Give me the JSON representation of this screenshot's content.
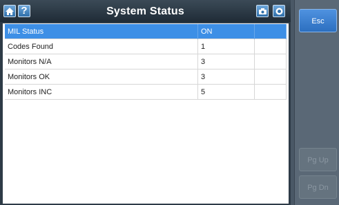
{
  "header": {
    "title": "System Status",
    "help_label": "?",
    "icons": [
      "home-icon",
      "help-icon",
      "camera-icon",
      "record-icon"
    ]
  },
  "table": {
    "rows": [
      {
        "name": "MIL Status",
        "value": "ON",
        "extra": "",
        "selected": true
      },
      {
        "name": "Codes Found",
        "value": "1",
        "extra": "",
        "selected": false
      },
      {
        "name": "Monitors N/A",
        "value": "3",
        "extra": "",
        "selected": false
      },
      {
        "name": "Monitors OK",
        "value": "3",
        "extra": "",
        "selected": false
      },
      {
        "name": "Monitors INC",
        "value": "5",
        "extra": "",
        "selected": false
      }
    ]
  },
  "side": {
    "esc_label": "Esc",
    "pgup_label": "Pg Up",
    "pgdn_label": "Pg Dn"
  },
  "colors": {
    "selected_row": "#3d8fe6",
    "header_bg": "#2a3642",
    "button_blue": "#3b82d4",
    "disabled_button": "#65737f"
  }
}
